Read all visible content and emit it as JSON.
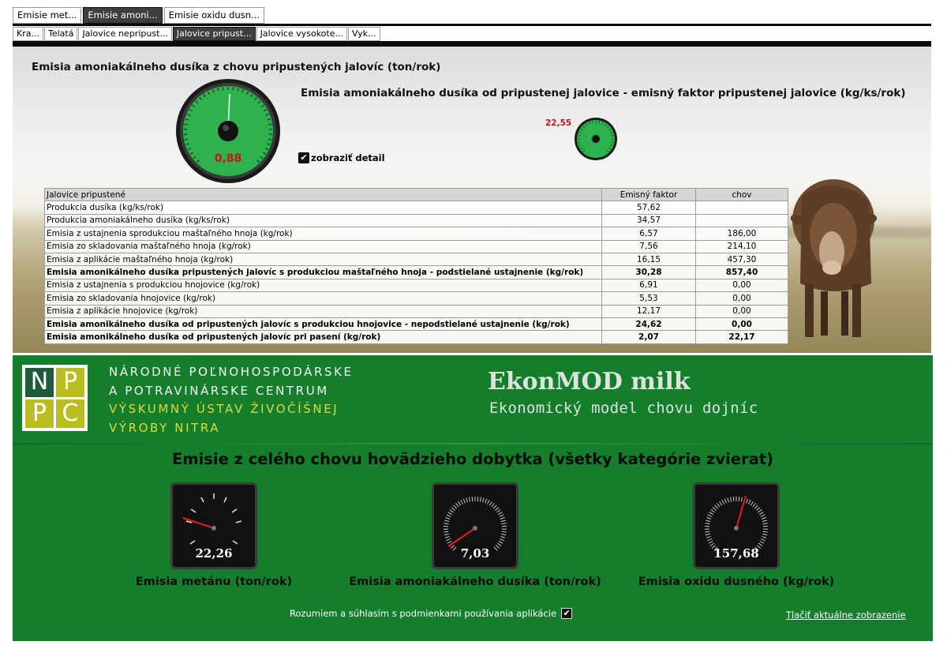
{
  "tabs_top": [
    {
      "label": "Emisie met...",
      "active": false
    },
    {
      "label": "Emisie amoni...",
      "active": true
    },
    {
      "label": "Emisie oxidu dusn...",
      "active": false
    }
  ],
  "tabs_sub": [
    {
      "label": "Kra...",
      "active": false
    },
    {
      "label": "Telatá",
      "active": false
    },
    {
      "label": "Jalovice nepripust...",
      "active": false
    },
    {
      "label": "Jalovice pripust...",
      "active": true
    },
    {
      "label": "Jalovice vysokote...",
      "active": false
    },
    {
      "label": "Vyk...",
      "active": false
    }
  ],
  "panel": {
    "title_left": "Emisia amoniakálneho dusíka z chovu pripustených jalovíc (ton/rok)",
    "title_right": "Emisia amoniakálneho dusíka od pripustenej jalovice - emisný faktor pripustenej jalovice  (kg/ks/rok)",
    "gauge_big_value": "0,88",
    "gauge_small_value": "22,55",
    "detail_label": "zobraziť detail",
    "detail_checked": true
  },
  "table": {
    "headers": [
      "Jalovice pripustené",
      "Emisný faktor",
      "chov"
    ],
    "rows": [
      {
        "label": "Produkcia dusíka (kg/ks/rok)",
        "factor": "57,62",
        "chov": "",
        "bold": false
      },
      {
        "label": "Produkcia amoniakálneho dusíka (kg/ks/rok)",
        "factor": "34,57",
        "chov": "",
        "bold": false
      },
      {
        "label": "Emisia z ustajnenia sprodukciou maštaľného hnoja (kg/rok)",
        "factor": "6,57",
        "chov": "186,00",
        "bold": false
      },
      {
        "label": "Emisia zo skladovania maštaľného hnoja (kg/rok)",
        "factor": "7,56",
        "chov": "214,10",
        "bold": false
      },
      {
        "label": "Emisia z aplikácie maštaľného hnoja (kg/rok)",
        "factor": "16,15",
        "chov": "457,30",
        "bold": false
      },
      {
        "label": "Emisia amonikálneho dusíka pripustených jalovíc s produkciou maštaľného hnoja - podstielané ustajnenie (kg/rok)",
        "factor": "30,28",
        "chov": "857,40",
        "bold": true
      },
      {
        "label": "Emisia z ustajnenia s produkciou hnojovice (kg/rok)",
        "factor": "6,91",
        "chov": "0,00",
        "bold": false
      },
      {
        "label": "Emisia zo skladovania hnojovice (kg/rok)",
        "factor": "5,53",
        "chov": "0,00",
        "bold": false
      },
      {
        "label": "Emisia z aplikácie hnojovice (kg/rok)",
        "factor": "12,17",
        "chov": "0,00",
        "bold": false
      },
      {
        "label": "Emisia amonikálneho dusíka od pripustených jalovíc s produkciou hnojovice - nepodstielané ustajnenie (kg/rok)",
        "factor": "24,62",
        "chov": "0,00",
        "bold": true
      },
      {
        "label": "Emisia amonikálneho dusíka od pripustených jalovíc pri pasení (kg/rok)",
        "factor": "2,07",
        "chov": "22,17",
        "bold": true
      }
    ]
  },
  "footer": {
    "logo_letters": [
      "N",
      "P",
      "P",
      "C"
    ],
    "org_lines": [
      "NÁRODNÉ POĽNOHOSPODÁRSKE",
      "A POTRAVINÁRSKE CENTRUM",
      "VÝSKUMNÝ ÚSTAV ŽIVOČÍŠNEJ",
      "VÝROBY NITRA"
    ],
    "app_name": "EkonMOD milk",
    "app_subtitle": "Ekonomický model chovu dojníc",
    "section_title": "Emisie z celého chovu hovädzieho dobytka (všetky kategórie zvierat)",
    "dials": [
      {
        "value": "22,26",
        "label": "Emisia metánu (ton/rok)"
      },
      {
        "value": "7,03",
        "label": "Emisia amoniakálneho dusíka (ton/rok)"
      },
      {
        "value": "157,68",
        "label": "Emisia oxidu dusného (kg/rok)"
      }
    ],
    "agree_text": "Rozumiem a súhlasím s podmienkami používania aplikácie",
    "agree_checked": true,
    "print_link": "Tlačiť aktuálne zobrazenie"
  },
  "colors": {
    "accent_green": "#157e2d",
    "gauge_green": "#2eb24e",
    "value_red": "#d01010",
    "needle_red": "#e81c1c"
  },
  "icons": [
    "checkbox-checked-icon",
    "gauge-icon",
    "dial-icon"
  ]
}
